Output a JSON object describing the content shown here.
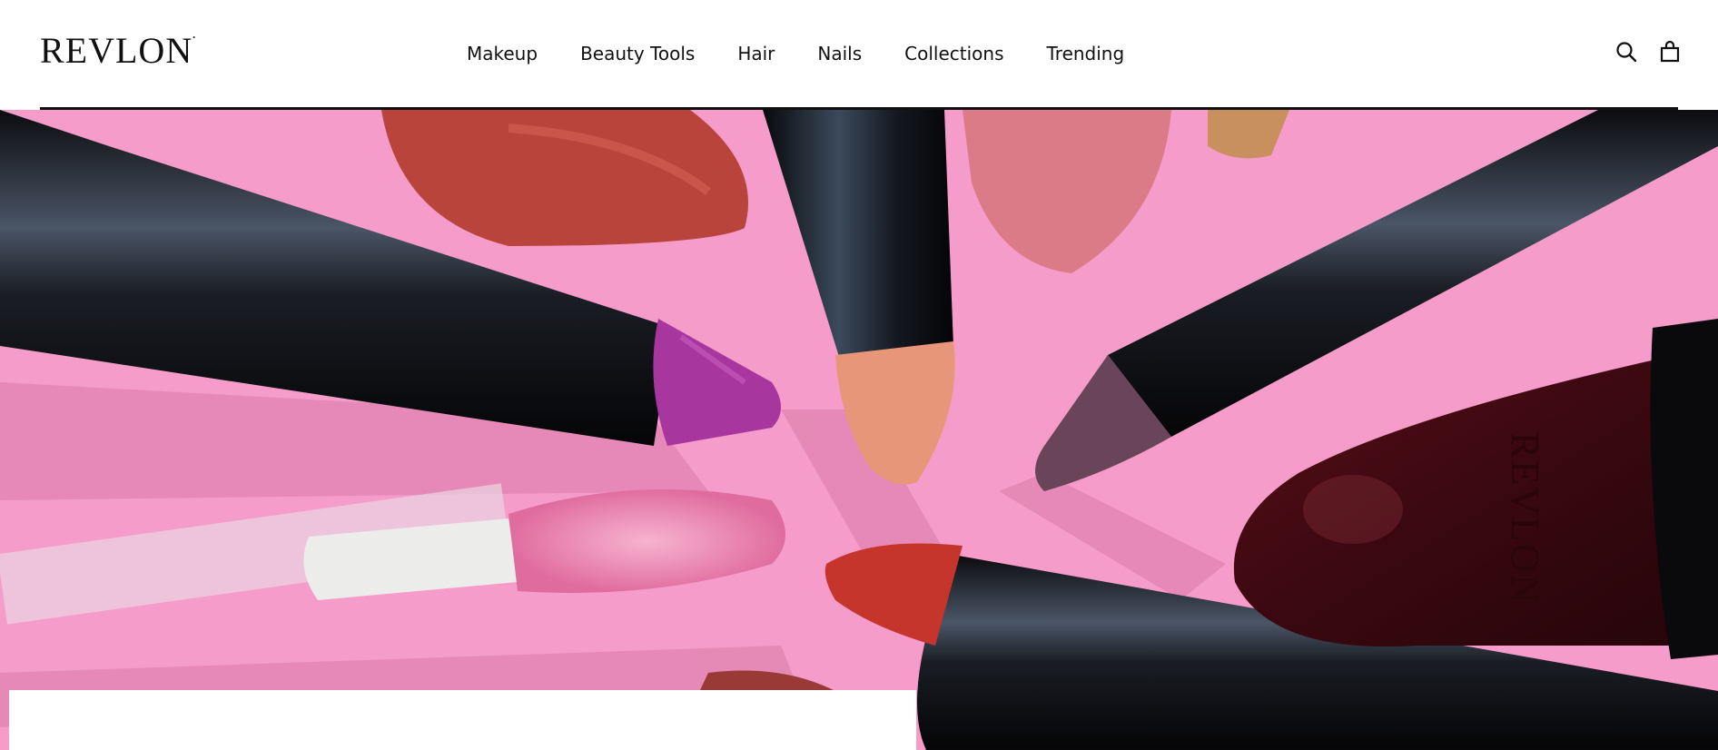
{
  "header": {
    "logo_text": "REVLON",
    "nav": [
      "Makeup",
      "Beauty Tools",
      "Hair",
      "Nails",
      "Collections",
      "Trending"
    ],
    "icons": {
      "search": "search-icon",
      "cart": "shopping-bag-icon"
    }
  },
  "hero": {
    "background_color": "#f59cca",
    "product_engraving": "REVLON"
  },
  "colors": {
    "text": "#111111",
    "accent": "#f59cca"
  }
}
